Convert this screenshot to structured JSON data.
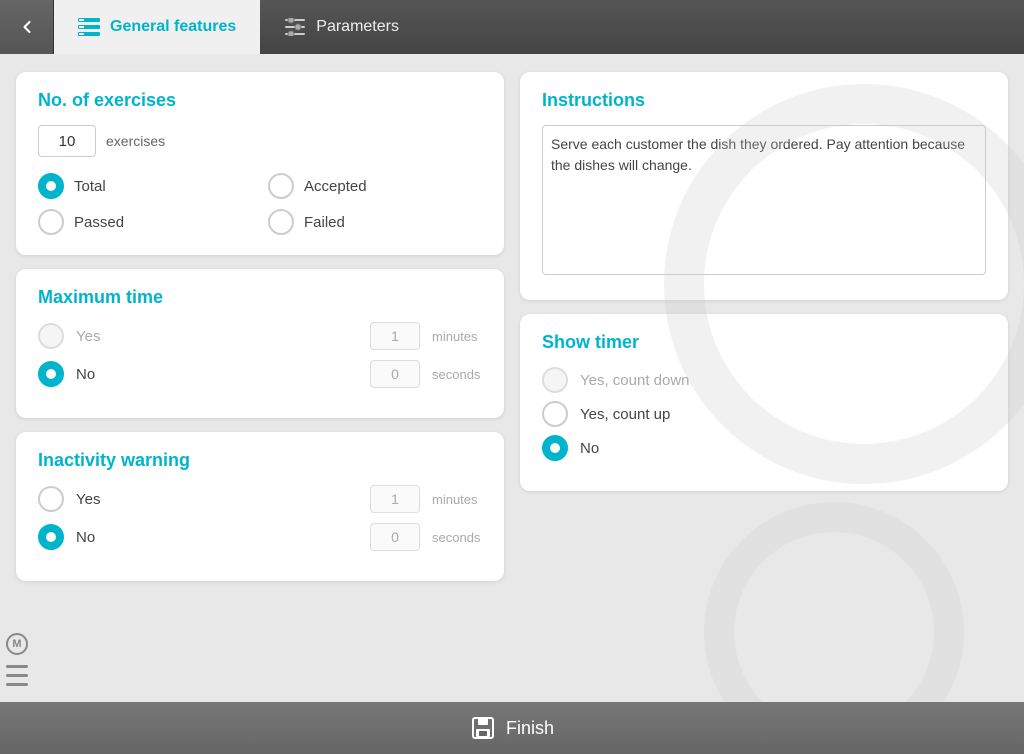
{
  "nav": {
    "back_label": "Back",
    "tab_general_label": "General features",
    "tab_params_label": "Parameters"
  },
  "exercises": {
    "title": "No. of exercises",
    "value": "10",
    "unit_label": "exercises",
    "radio_options": [
      {
        "id": "total",
        "label": "Total",
        "selected": true,
        "disabled": false
      },
      {
        "id": "accepted",
        "label": "Accepted",
        "selected": false,
        "disabled": false
      },
      {
        "id": "passed",
        "label": "Passed",
        "selected": false,
        "disabled": false
      },
      {
        "id": "failed",
        "label": "Failed",
        "selected": false,
        "disabled": false
      }
    ]
  },
  "max_time": {
    "title": "Maximum time",
    "yes_label": "Yes",
    "no_label": "No",
    "yes_selected": false,
    "no_selected": true,
    "minutes_value": "1",
    "seconds_value": "0",
    "minutes_label": "minutes",
    "seconds_label": "seconds"
  },
  "inactivity": {
    "title": "Inactivity warning",
    "yes_label": "Yes",
    "no_label": "No",
    "yes_selected": false,
    "no_selected": true,
    "minutes_value": "1",
    "seconds_value": "0",
    "minutes_label": "minutes",
    "seconds_label": "seconds"
  },
  "instructions": {
    "title": "Instructions",
    "text": "Serve each customer the dish they ordered. Pay attention because the dishes will change."
  },
  "show_timer": {
    "title": "Show timer",
    "options": [
      {
        "id": "count_down",
        "label": "Yes, count down",
        "selected": false,
        "disabled": true
      },
      {
        "id": "count_up",
        "label": "Yes, count up",
        "selected": false,
        "disabled": false
      },
      {
        "id": "no",
        "label": "No",
        "selected": true,
        "disabled": false
      }
    ]
  },
  "footer": {
    "finish_label": "Finish"
  }
}
